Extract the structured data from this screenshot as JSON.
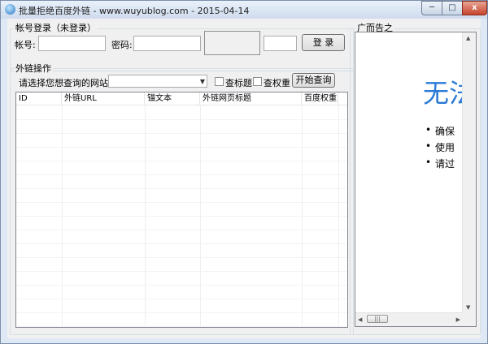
{
  "window": {
    "title": "批量拒绝百度外链 - www.wuyublog.com - 2015-04-14",
    "minimize_glyph": "─",
    "maximize_glyph": "□",
    "close_glyph": "x"
  },
  "login": {
    "group_label": "帐号登录（未登录）",
    "account_label": "帐号:",
    "account_value": "",
    "password_label": "密码:",
    "password_value": "",
    "captcha_value": "",
    "login_button": "登 录"
  },
  "links": {
    "group_label": "外链操作",
    "site_label": "请选择您想查询的网站地址:",
    "site_selected": "",
    "check_title_label": "查标题",
    "check_weight_label": "查权重",
    "start_button": "开始查询",
    "table": {
      "columns": [
        "ID",
        "外链URL",
        "锚文本",
        "外链网页标题",
        "百度权重"
      ],
      "rows": []
    }
  },
  "ads": {
    "group_label": "广而告之",
    "error_title": "无法",
    "bullets": [
      "确保",
      "使用",
      "请过"
    ],
    "scroll_thumb_glyph": "|||"
  },
  "colors": {
    "accent": "#2a7ad6",
    "window_frame": "#dfe9f5",
    "close_button": "#c7432b"
  }
}
